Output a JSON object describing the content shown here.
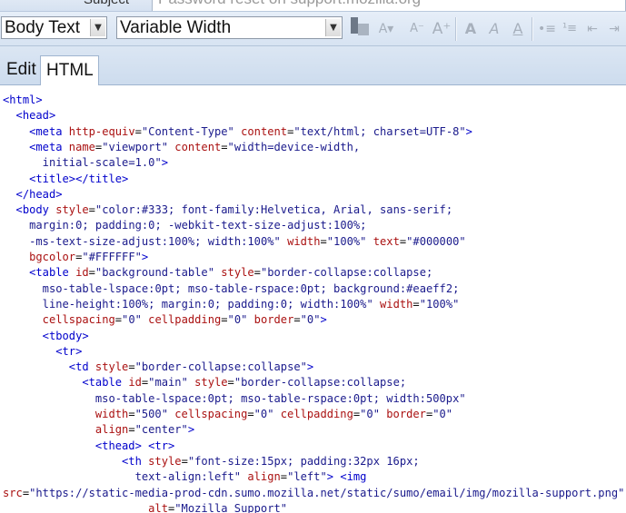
{
  "subject": {
    "label": "Subject",
    "value": "Password reset on support.mozilla.org"
  },
  "toolbar": {
    "paragraph_style": "Body Text",
    "font": "Variable Width",
    "icons": [
      "font-color",
      "font-size-decrease",
      "font-size-smaller",
      "font-size-larger",
      "bold",
      "italic",
      "underline",
      "bulleted-list",
      "numbered-list",
      "outdent",
      "indent"
    ]
  },
  "tabs": [
    {
      "label": "Edit",
      "active": false
    },
    {
      "label": "HTML",
      "active": true
    }
  ],
  "code_lines": [
    {
      "indent": 0,
      "parts": [
        [
          "t",
          "<html>"
        ]
      ]
    },
    {
      "indent": 2,
      "parts": [
        [
          "t",
          "<head>"
        ]
      ]
    },
    {
      "indent": 4,
      "parts": [
        [
          "t",
          "<meta "
        ],
        [
          "a",
          "http-equiv"
        ],
        [
          "x",
          "="
        ],
        [
          "s",
          "\"Content-Type\""
        ],
        [
          "x",
          " "
        ],
        [
          "a",
          "content"
        ],
        [
          "x",
          "="
        ],
        [
          "s",
          "\"text/html; charset=UTF-8\""
        ],
        [
          "t",
          ">"
        ]
      ]
    },
    {
      "indent": 4,
      "parts": [
        [
          "t",
          "<meta "
        ],
        [
          "a",
          "name"
        ],
        [
          "x",
          "="
        ],
        [
          "s",
          "\"viewport\""
        ],
        [
          "x",
          " "
        ],
        [
          "a",
          "content"
        ],
        [
          "x",
          "="
        ],
        [
          "s",
          "\"width=device-width,"
        ]
      ]
    },
    {
      "indent": 6,
      "parts": [
        [
          "s",
          "initial-scale=1.0\""
        ],
        [
          "t",
          ">"
        ]
      ]
    },
    {
      "indent": 4,
      "parts": [
        [
          "t",
          "<title></title>"
        ]
      ]
    },
    {
      "indent": 2,
      "parts": [
        [
          "t",
          "</head>"
        ]
      ]
    },
    {
      "indent": 2,
      "parts": [
        [
          "t",
          "<body "
        ],
        [
          "a",
          "style"
        ],
        [
          "x",
          "="
        ],
        [
          "s",
          "\"color:#333; font-family:Helvetica, Arial, sans-serif;"
        ]
      ]
    },
    {
      "indent": 4,
      "parts": [
        [
          "s",
          "margin:0; padding:0; -webkit-text-size-adjust:100%;"
        ]
      ]
    },
    {
      "indent": 4,
      "parts": [
        [
          "s",
          "-ms-text-size-adjust:100%; width:100%\""
        ],
        [
          "x",
          " "
        ],
        [
          "a",
          "width"
        ],
        [
          "x",
          "="
        ],
        [
          "s",
          "\"100%\""
        ],
        [
          "x",
          " "
        ],
        [
          "a",
          "text"
        ],
        [
          "x",
          "="
        ],
        [
          "s",
          "\"#000000\""
        ]
      ]
    },
    {
      "indent": 4,
      "parts": [
        [
          "a",
          "bgcolor"
        ],
        [
          "x",
          "="
        ],
        [
          "s",
          "\"#FFFFFF\""
        ],
        [
          "t",
          ">"
        ]
      ]
    },
    {
      "indent": 4,
      "parts": [
        [
          "t",
          "<table "
        ],
        [
          "a",
          "id"
        ],
        [
          "x",
          "="
        ],
        [
          "s",
          "\"background-table\""
        ],
        [
          "x",
          " "
        ],
        [
          "a",
          "style"
        ],
        [
          "x",
          "="
        ],
        [
          "s",
          "\"border-collapse:collapse;"
        ]
      ]
    },
    {
      "indent": 6,
      "parts": [
        [
          "s",
          "mso-table-lspace:0pt; mso-table-rspace:0pt; background:#eaeff2;"
        ]
      ]
    },
    {
      "indent": 6,
      "parts": [
        [
          "s",
          "line-height:100%; margin:0; padding:0; width:100%\""
        ],
        [
          "x",
          " "
        ],
        [
          "a",
          "width"
        ],
        [
          "x",
          "="
        ],
        [
          "s",
          "\"100%\""
        ]
      ]
    },
    {
      "indent": 6,
      "parts": [
        [
          "a",
          "cellspacing"
        ],
        [
          "x",
          "="
        ],
        [
          "s",
          "\"0\""
        ],
        [
          "x",
          " "
        ],
        [
          "a",
          "cellpadding"
        ],
        [
          "x",
          "="
        ],
        [
          "s",
          "\"0\""
        ],
        [
          "x",
          " "
        ],
        [
          "a",
          "border"
        ],
        [
          "x",
          "="
        ],
        [
          "s",
          "\"0\""
        ],
        [
          "t",
          ">"
        ]
      ]
    },
    {
      "indent": 6,
      "parts": [
        [
          "t",
          "<tbody>"
        ]
      ]
    },
    {
      "indent": 8,
      "parts": [
        [
          "t",
          "<tr>"
        ]
      ]
    },
    {
      "indent": 10,
      "parts": [
        [
          "t",
          "<td "
        ],
        [
          "a",
          "style"
        ],
        [
          "x",
          "="
        ],
        [
          "s",
          "\"border-collapse:collapse\""
        ],
        [
          "t",
          ">"
        ]
      ]
    },
    {
      "indent": 12,
      "parts": [
        [
          "t",
          "<table "
        ],
        [
          "a",
          "id"
        ],
        [
          "x",
          "="
        ],
        [
          "s",
          "\"main\""
        ],
        [
          "x",
          " "
        ],
        [
          "a",
          "style"
        ],
        [
          "x",
          "="
        ],
        [
          "s",
          "\"border-collapse:collapse;"
        ]
      ]
    },
    {
      "indent": 14,
      "parts": [
        [
          "s",
          "mso-table-lspace:0pt; mso-table-rspace:0pt; width:500px\""
        ]
      ]
    },
    {
      "indent": 14,
      "parts": [
        [
          "a",
          "width"
        ],
        [
          "x",
          "="
        ],
        [
          "s",
          "\"500\""
        ],
        [
          "x",
          " "
        ],
        [
          "a",
          "cellspacing"
        ],
        [
          "x",
          "="
        ],
        [
          "s",
          "\"0\""
        ],
        [
          "x",
          " "
        ],
        [
          "a",
          "cellpadding"
        ],
        [
          "x",
          "="
        ],
        [
          "s",
          "\"0\""
        ],
        [
          "x",
          " "
        ],
        [
          "a",
          "border"
        ],
        [
          "x",
          "="
        ],
        [
          "s",
          "\"0\""
        ]
      ]
    },
    {
      "indent": 14,
      "parts": [
        [
          "a",
          "align"
        ],
        [
          "x",
          "="
        ],
        [
          "s",
          "\"center\""
        ],
        [
          "t",
          ">"
        ]
      ]
    },
    {
      "indent": 14,
      "parts": [
        [
          "t",
          "<thead>"
        ],
        [
          "x",
          " "
        ],
        [
          "t",
          "<tr>"
        ]
      ]
    },
    {
      "indent": 18,
      "parts": [
        [
          "t",
          "<th "
        ],
        [
          "a",
          "style"
        ],
        [
          "x",
          "="
        ],
        [
          "s",
          "\"font-size:15px; padding:32px 16px;"
        ]
      ]
    },
    {
      "indent": 20,
      "parts": [
        [
          "s",
          "text-align:left\""
        ],
        [
          "x",
          " "
        ],
        [
          "a",
          "align"
        ],
        [
          "x",
          "="
        ],
        [
          "s",
          "\"left\""
        ],
        [
          "t",
          ">"
        ],
        [
          "x",
          " "
        ],
        [
          "t",
          "<img"
        ]
      ]
    },
    {
      "indent": 0,
      "parts": [
        [
          "a",
          "src"
        ],
        [
          "x",
          "="
        ],
        [
          "s",
          "\"https://static-media-prod-cdn.sumo.mozilla.net/static/sumo/email/img/mozilla-support.png\""
        ]
      ]
    },
    {
      "indent": 22,
      "parts": [
        [
          "a",
          "alt"
        ],
        [
          "x",
          "="
        ],
        [
          "s",
          "\"Mozilla Support\""
        ]
      ]
    }
  ]
}
